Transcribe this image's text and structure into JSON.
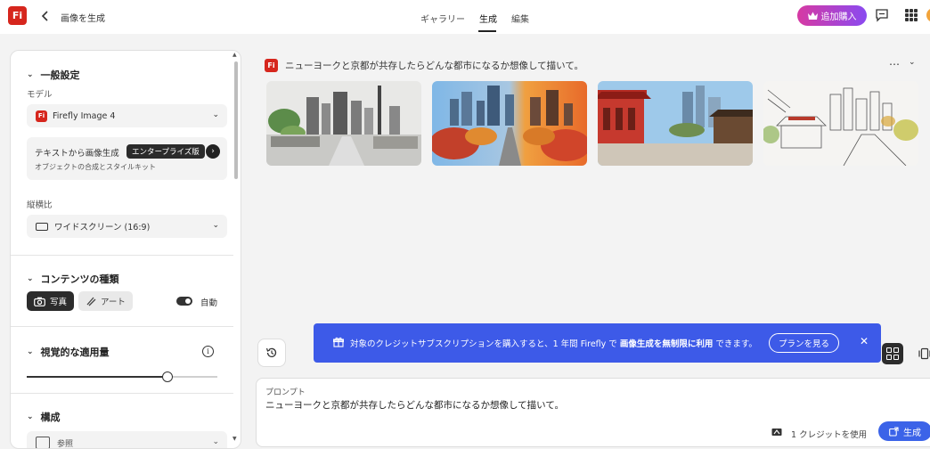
{
  "header": {
    "logo_text": "Fi",
    "page_title": "画像を生成",
    "tabs": [
      {
        "label": "ギャラリー"
      },
      {
        "label": "生成"
      },
      {
        "label": "編集"
      }
    ],
    "active_tab": "生成",
    "purchase_button": "追加購入",
    "icons": [
      "chevron-left-icon",
      "chat-icon",
      "apps-grid-icon",
      "avatar"
    ]
  },
  "panel": {
    "general_settings": {
      "heading": "一般設定",
      "model_label": "モデル",
      "model_value": "Firefly Image 4",
      "text_to_image": {
        "title": "テキストから画像生成",
        "badge": "エンタープライズ版",
        "subtitle": "オブジェクトの合成とスタイルキット"
      },
      "aspect_label": "縦横比",
      "aspect_value": "ワイドスクリーン (16:9)"
    },
    "content_type": {
      "heading": "コンテンツの種類",
      "photo_label": "写真",
      "art_label": "アート",
      "auto_label": "自動",
      "selected": "写真",
      "auto_enabled": true
    },
    "visual_intensity": {
      "heading": "視覚的な適用量",
      "value_fraction": 0.74
    },
    "composition": {
      "heading": "構成",
      "reference_label": "参照"
    }
  },
  "main": {
    "prompt_echo": "ニューヨークと京都が共存したらどんな都市になるか想像して描いて。",
    "more_icon": "⋯",
    "images": [
      {
        "name": "generated-image-1",
        "style": "sketch-color"
      },
      {
        "name": "generated-image-2",
        "style": "sunset-autumn"
      },
      {
        "name": "generated-image-3",
        "style": "temple-street"
      },
      {
        "name": "generated-image-4",
        "style": "line-sketch"
      }
    ],
    "banner": {
      "text_pre": "対象のクレジットサブスクリプションを購入すると、1 年間 Firefly で",
      "text_bold": "画像生成を無制限に利用",
      "text_post": "できます。",
      "button": "プランを見る",
      "close": "✕"
    },
    "prompt": {
      "label": "プロンプト",
      "value": "ニューヨークと京都が共存したらどんな都市になるか想像して描いて。",
      "credit_text": "1 クレジットを使用",
      "generate_button": "生成"
    }
  },
  "colors": {
    "brand_red": "#d6261d",
    "banner_blue": "#3d5ae8",
    "generate_blue": "#3b63e8"
  }
}
